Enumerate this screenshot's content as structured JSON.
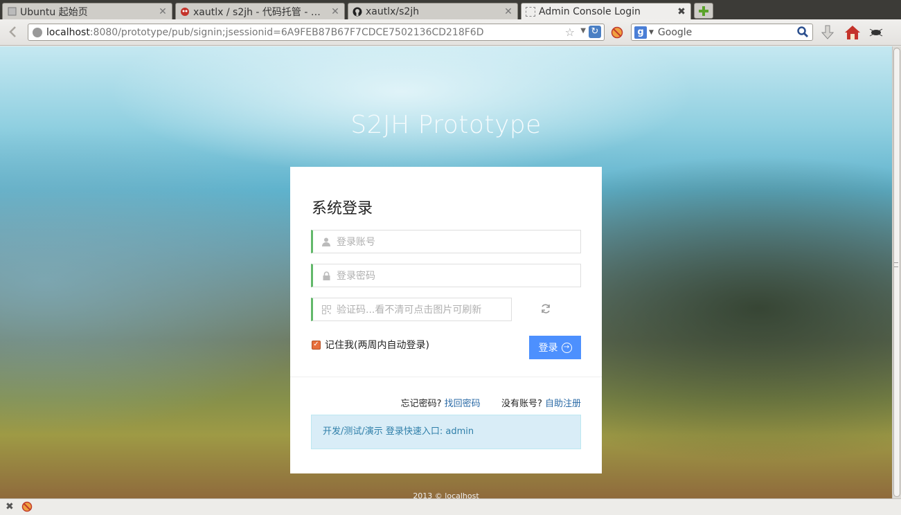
{
  "browser": {
    "tabs": [
      {
        "title": "Ubuntu 起始页",
        "icon": "page-icon",
        "active": false
      },
      {
        "title": "xautlx / s2jh - 代码托管 - 开…",
        "icon": "gitee-icon",
        "active": false
      },
      {
        "title": "xautlx/s2jh",
        "icon": "github-icon",
        "active": false
      },
      {
        "title": "Admin Console Login",
        "icon": "blank-page-icon",
        "active": true
      }
    ],
    "url_host": "localhost",
    "url_rest": ":8080/prototype/pub/signin;jsessionid=6A9FEB87B67F7CDCE7502136CD218F6D",
    "search_placeholder": "Google",
    "search_engine_letter": "g"
  },
  "page": {
    "brand": "S2JH Prototype",
    "panel_title": "系统登录",
    "username_placeholder": "登录账号",
    "password_placeholder": "登录密码",
    "captcha_placeholder": "验证码...看不清可点击图片可刷新",
    "remember_label": "记住我(两周内自动登录)",
    "login_label": "登录",
    "forgot_text": "忘记密码?",
    "forgot_link": "找回密码",
    "noaccount_text": "没有账号?",
    "register_link": "自助注册",
    "quick_entry": "开发/测试/演示 登录快速入口: admin",
    "footer": "2013 © localhost"
  },
  "colors": {
    "login_button": "#4d90fe",
    "field_accent": "#62b86a",
    "link": "#2a6aa6",
    "info_box_bg": "#d9edf7"
  }
}
